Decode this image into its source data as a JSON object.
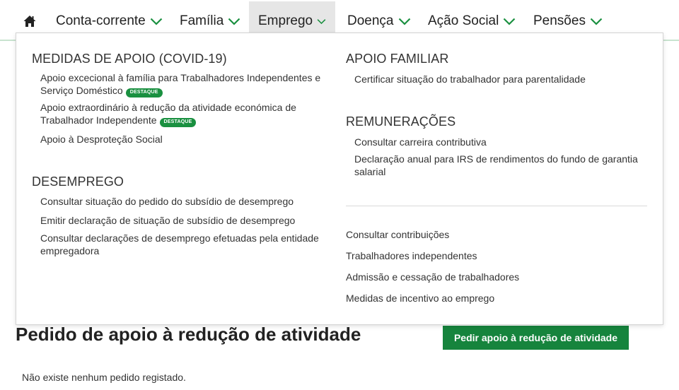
{
  "nav": {
    "home_icon": "home-icon",
    "items": [
      {
        "label": "Conta-corrente"
      },
      {
        "label": "Família"
      },
      {
        "label": "Emprego",
        "active": true
      },
      {
        "label": "Doença"
      },
      {
        "label": "Ação Social"
      },
      {
        "label": "Pensões"
      }
    ],
    "chevron_icon": "chevron-down-icon"
  },
  "menu": {
    "covid": {
      "title": "MEDIDAS DE APOIO (COVID-19)",
      "links": [
        {
          "line1": "Apoio excecional à família para Trabalhadores Independentes e",
          "line2": "Serviço Doméstico",
          "badge": "DESTAQUE"
        },
        {
          "line1": "Apoio extraordinário à redução da atividade económica de",
          "line2": "Trabalhador Independente",
          "badge": "DESTAQUE"
        },
        {
          "line1": "Apoio à Desproteção Social"
        }
      ]
    },
    "desemprego": {
      "title": "DESEMPREGO",
      "links": [
        {
          "line1": "Consultar situação do pedido do subsídio de desemprego"
        },
        {
          "line1": "Emitir declaração de situação de subsídio de desemprego"
        },
        {
          "line1": "Consultar declarações de desemprego efetuadas pela entidade",
          "line2": "empregadora"
        }
      ]
    },
    "apoio_familiar": {
      "title": "APOIO FAMILIAR",
      "links": [
        {
          "line1": "Certificar situação do trabalhador para parentalidade"
        }
      ]
    },
    "remuneracoes": {
      "title": "REMUNERAÇÕES",
      "links": [
        {
          "line1": "Consultar carreira contributiva"
        },
        {
          "line1": "Declaração anual para IRS de rendimentos do fundo de garantia",
          "line2": "salarial"
        }
      ]
    },
    "other_links": [
      "Consultar contribuições",
      "Trabalhadores independentes",
      "Admissão e cessação de trabalhadores",
      "Medidas de incentivo ao emprego"
    ]
  },
  "page": {
    "title": "Pedido de apoio à redução de atividade",
    "cta_label": "Pedir apoio à redução de atividade",
    "empty_text": "Não existe nenhum pedido registado."
  },
  "colors": {
    "accent": "#16843d",
    "badge": "#1a9040",
    "nav_active_bg": "#e6e6e6"
  }
}
